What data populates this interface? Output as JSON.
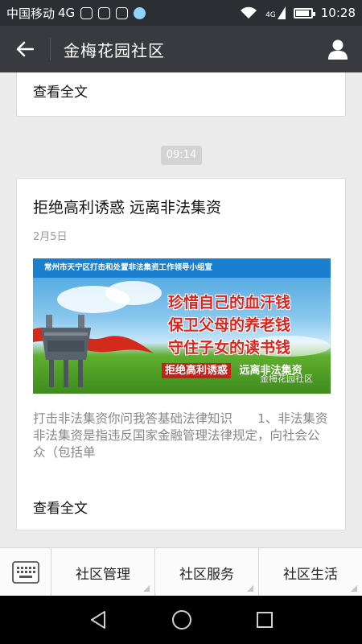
{
  "status_bar": {
    "carrier": "中国移动",
    "network": "4G",
    "network_small": "4G",
    "time": "10:28",
    "battery_level": 0.8,
    "notification_icons": [
      "weibo-icon",
      "sim-icon",
      "camera-icon",
      "round-app-icon"
    ]
  },
  "header": {
    "title": "金梅花园社区"
  },
  "feed": {
    "top_card": {
      "read_more": "查看全文"
    },
    "time_badge": "09:14",
    "article": {
      "title": "拒绝高利诱惑 远离非法集资",
      "date": "2月5日",
      "banner": {
        "issuer": "常州市天宁区打击和处置非法集资工作领导小组宣",
        "slogans": [
          "珍惜自己的血汗钱",
          "保卫父母的养老钱",
          "守住子女的读书钱"
        ],
        "bottom_left": "拒绝高利诱惑",
        "bottom_right": "远离非法集资",
        "watermark": "金梅花园社区"
      },
      "excerpt": "打击非法集资你问我答基础法律知识　　1、非法集资　　非法集资是指违反国家金融管理法律规定，向社会公众（包括单",
      "read_more": "查看全文"
    }
  },
  "menu": {
    "items": [
      {
        "label": "社区管理"
      },
      {
        "label": "社区服务"
      },
      {
        "label": "社区生活"
      }
    ]
  },
  "colors": {
    "title_bar": "#393a3f",
    "status_bar": "#2b2f33",
    "slogan_red": "#e0221b"
  }
}
